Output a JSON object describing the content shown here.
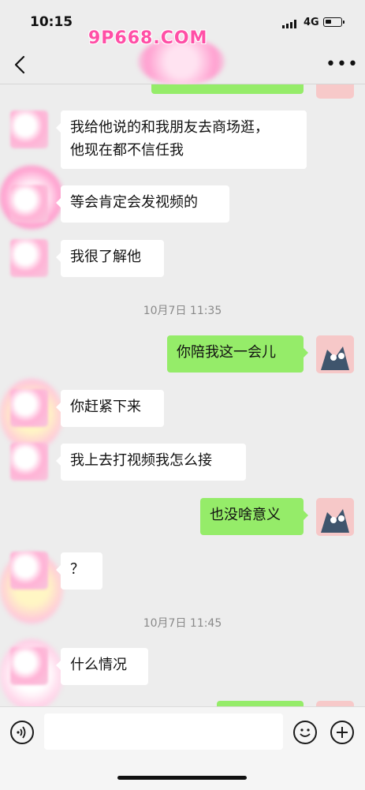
{
  "status": {
    "time": "10:15",
    "network": "4G"
  },
  "watermark": {
    "brand": "9P668.COM"
  },
  "messages": [
    {
      "side": "in",
      "text": "我给他说的和我朋友去商场逛，\n他现在都不信任我"
    },
    {
      "side": "in",
      "text": "等会肯定会发视频的"
    },
    {
      "side": "in",
      "text": "我很了解他"
    },
    {
      "side": "out",
      "text": "你陪我这一会儿"
    },
    {
      "side": "in",
      "text": "你赶紧下来"
    },
    {
      "side": "in",
      "text": "我上去打视频我怎么接"
    },
    {
      "side": "out",
      "text": "也没啥意义"
    },
    {
      "side": "in",
      "text": "？"
    },
    {
      "side": "in",
      "text": "什么情况"
    }
  ],
  "timestamps": [
    "10月7日 11:35",
    "10月7日 11:45"
  ],
  "icons": {
    "back": "chevron-left-icon",
    "more": "more-icon",
    "voice": "voice-icon",
    "emoji": "emoji-icon",
    "plus": "plus-icon"
  },
  "colors": {
    "incoming_bubble": "#ffffff",
    "outgoing_bubble": "#95ec69",
    "background": "#ededed"
  }
}
